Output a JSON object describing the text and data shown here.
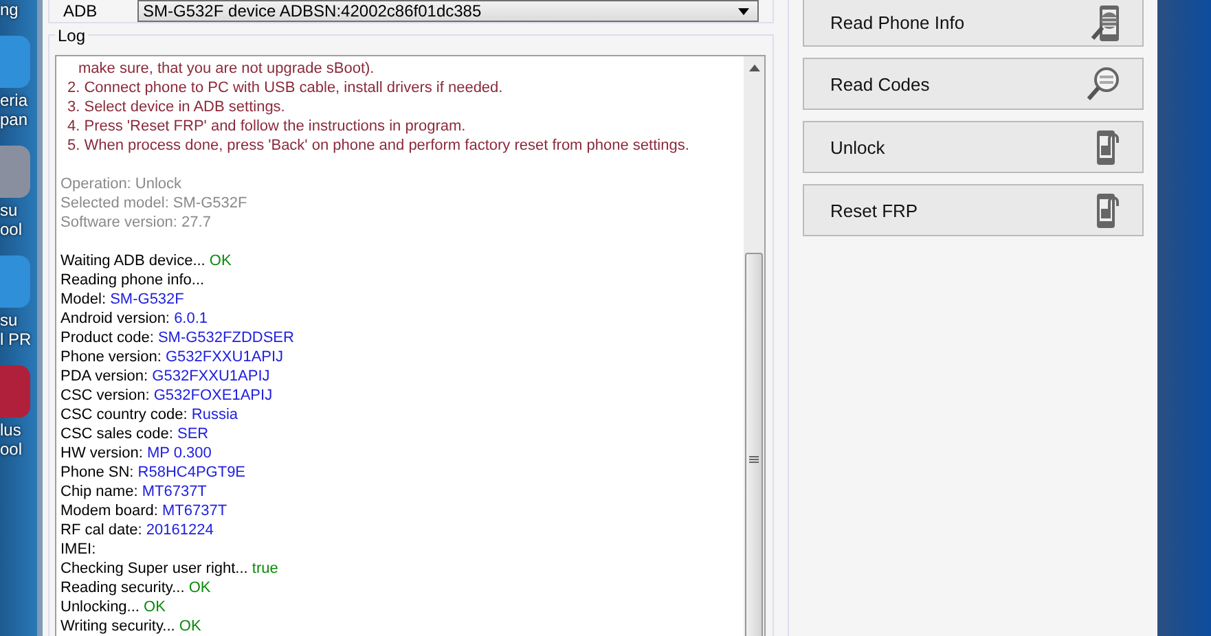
{
  "desktop_icons": [
    {
      "labels": [
        "ng"
      ]
    },
    {
      "labels": [
        "eria",
        "pan"
      ]
    },
    {
      "labels": [
        "su",
        "ool"
      ]
    },
    {
      "labels": [
        "su",
        "l PR"
      ]
    },
    {
      "labels": [
        "lus",
        "ool"
      ]
    }
  ],
  "adb": {
    "label": "ADB",
    "device": "SM-G532F device ADBSN:42002c86f01dc385"
  },
  "log": {
    "title": "Log",
    "blocks": [
      [
        {
          "kind": "step_cont",
          "text": "make sure, that you are not upgrade sBoot)."
        },
        {
          "kind": "step",
          "text": "2. Connect phone to PC with USB cable, install drivers if needed."
        },
        {
          "kind": "step",
          "text": "3. Select device in ADB settings."
        },
        {
          "kind": "step",
          "text": "4. Press 'Reset FRP' and follow the instructions in program."
        },
        {
          "kind": "step",
          "text": "5. When process done, press 'Back' on phone and perform factory reset from phone settings."
        }
      ],
      [
        {
          "kind": "info",
          "text": "Operation: Unlock"
        },
        {
          "kind": "info",
          "text": "Selected model: SM-G532F"
        },
        {
          "kind": "info",
          "text": "Software version: 27.7"
        }
      ],
      [
        {
          "kind": "plain",
          "text": "Waiting ADB device...",
          "value": {
            "kind": "ok",
            "text": "OK"
          }
        },
        {
          "kind": "plain",
          "text": "Reading phone info..."
        },
        {
          "kind": "plain",
          "text": "Model:",
          "value": {
            "kind": "data",
            "text": "SM-G532F"
          }
        },
        {
          "kind": "plain",
          "text": "Android version:",
          "value": {
            "kind": "data",
            "text": "6.0.1"
          }
        },
        {
          "kind": "plain",
          "text": "Product code:",
          "value": {
            "kind": "data",
            "text": "SM-G532FZDDSER"
          }
        },
        {
          "kind": "plain",
          "text": "Phone version:",
          "value": {
            "kind": "data",
            "text": "G532FXXU1APIJ"
          }
        },
        {
          "kind": "plain",
          "text": "PDA version:",
          "value": {
            "kind": "data",
            "text": "G532FXXU1APIJ"
          }
        },
        {
          "kind": "plain",
          "text": "CSC version:",
          "value": {
            "kind": "data",
            "text": "G532FOXE1APIJ"
          }
        },
        {
          "kind": "plain",
          "text": "CSC country code:",
          "value": {
            "kind": "data",
            "text": "Russia"
          }
        },
        {
          "kind": "plain",
          "text": "CSC sales code:",
          "value": {
            "kind": "data",
            "text": "SER"
          }
        },
        {
          "kind": "plain",
          "text": "HW version:",
          "value": {
            "kind": "data",
            "text": "MP 0.300"
          }
        },
        {
          "kind": "plain",
          "text": "Phone SN:",
          "value": {
            "kind": "data",
            "text": "R58HC4PGT9E"
          }
        },
        {
          "kind": "plain",
          "text": "Chip name:",
          "value": {
            "kind": "data",
            "text": "MT6737T"
          }
        },
        {
          "kind": "plain",
          "text": "Modem board:",
          "value": {
            "kind": "data",
            "text": "MT6737T"
          }
        },
        {
          "kind": "plain",
          "text": "RF cal date:",
          "value": {
            "kind": "data",
            "text": "20161224"
          }
        },
        {
          "kind": "plain",
          "text": "IMEI:"
        },
        {
          "kind": "plain",
          "text": "Checking Super user right...",
          "value": {
            "kind": "ok",
            "text": "true"
          }
        },
        {
          "kind": "plain",
          "text": "Reading security...",
          "value": {
            "kind": "ok",
            "text": "OK"
          }
        },
        {
          "kind": "plain",
          "text": "Unlocking...",
          "value": {
            "kind": "ok",
            "text": "OK"
          }
        },
        {
          "kind": "plain",
          "text": "Writing security...",
          "value": {
            "kind": "ok",
            "text": "OK"
          }
        }
      ]
    ]
  },
  "actions": [
    {
      "label": "Read Phone Info",
      "kind": "phone-search"
    },
    {
      "label": "Read Codes",
      "kind": "code-search"
    },
    {
      "label": "Unlock",
      "kind": "phone-lock"
    },
    {
      "label": "Reset FRP",
      "kind": "phone-lock"
    }
  ]
}
